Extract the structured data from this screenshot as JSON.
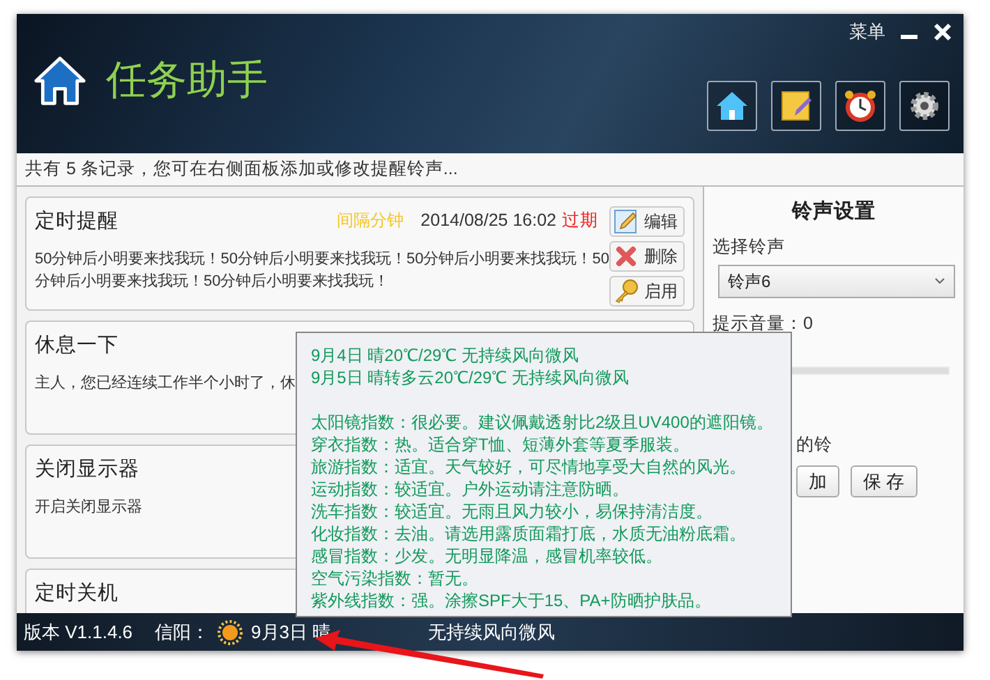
{
  "window": {
    "title": "任务助手",
    "menu": "菜单"
  },
  "info_bar": "共有 5 条记录，您可在右侧面板添加或修改提醒铃声...",
  "tasks": [
    {
      "title": "定时提醒",
      "type": "间隔分钟",
      "datetime": "2014/08/25 16:02",
      "status": "过期",
      "body": "50分钟后小明要来找我玩！50分钟后小明要来找我玩！50分钟后小明要来找我玩！50分钟后小明要来找我玩！50分钟后小明要来找我玩！",
      "actions": [
        {
          "kind": "edit",
          "label": "编辑"
        },
        {
          "kind": "delete",
          "label": "删除"
        },
        {
          "kind": "enable",
          "label": "启用"
        }
      ]
    },
    {
      "title": "休息一下",
      "body": "主人，您已经连续工作半个小时了，休"
    },
    {
      "title": "关闭显示器",
      "body": "开启关闭显示器"
    },
    {
      "title": "定时关机"
    }
  ],
  "ringtone_panel": {
    "title": "铃声设置",
    "select_label": "选择铃声",
    "select_value": "铃声6",
    "volume_label": "提示音量：0",
    "volume": {
      "level": 0
    },
    "option_label": "的铃",
    "buttons": [
      "加",
      "保 存"
    ]
  },
  "status_bar": {
    "version": "版本 V1.1.4.6",
    "city": "信阳：",
    "weather_date": "9月3日 晴",
    "weather_rest": "无持续风向微风"
  },
  "weather_popup": {
    "forecast": [
      "9月4日 晴20℃/29℃ 无持续风向微风",
      "9月5日 晴转多云20℃/29℃ 无持续风向微风"
    ],
    "indices": [
      "太阳镜指数：很必要。建议佩戴透射比2级且UV400的遮阳镜。",
      "穿衣指数：热。适合穿T恤、短薄外套等夏季服装。",
      "旅游指数：适宜。天气较好，可尽情地享受大自然的风光。",
      "运动指数：较适宜。户外运动请注意防晒。",
      "洗车指数：较适宜。无雨且风力较小，易保持清洁度。",
      "化妆指数：去油。请选用露质面霜打底，水质无油粉底霜。",
      "感冒指数：少发。无明显降温，感冒机率较低。",
      "空气污染指数：暂无。",
      "紫外线指数：强。涂擦SPF大于15、PA+防晒护肤品。"
    ]
  }
}
